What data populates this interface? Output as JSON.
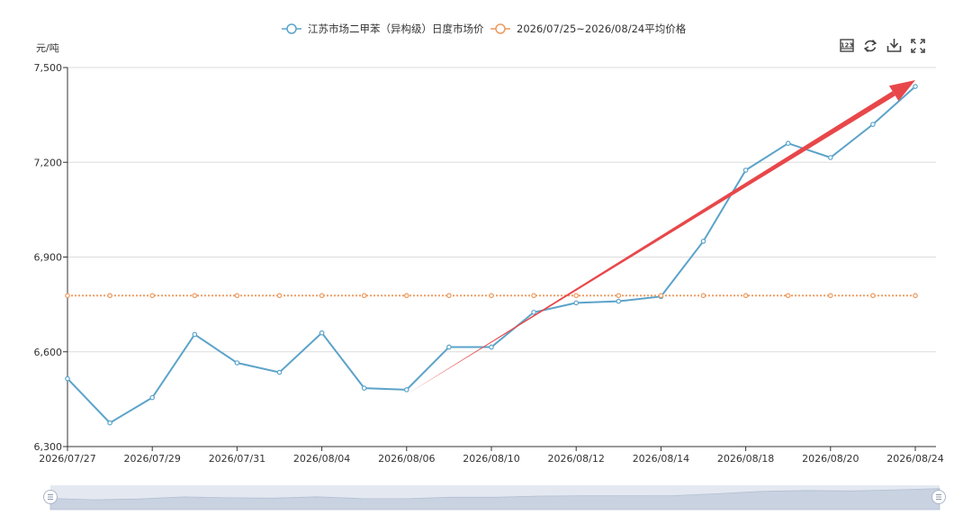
{
  "chart_data": {
    "type": "line",
    "y_unit_label": "元/吨",
    "ylim": [
      6300,
      7500
    ],
    "y_ticks": [
      6300,
      6600,
      6900,
      7200,
      7500
    ],
    "y_tick_labels": [
      "6,300",
      "6,600",
      "6,900",
      "7,200",
      "7,500"
    ],
    "x_tick_labels": [
      "2026/07/27",
      "2026/07/29",
      "2026/07/31",
      "2026/08/04",
      "2026/08/06",
      "2026/08/10",
      "2026/08/12",
      "2026/08/14",
      "2026/08/18",
      "2026/08/20",
      "2026/08/24"
    ],
    "grid": true,
    "legend_position": "top-center",
    "series": [
      {
        "name": "江苏市场二甲苯（异构级）日度市场价",
        "color": "#5ba3c9",
        "values": [
          6515,
          6375,
          6455,
          6655,
          6565,
          6535,
          6660,
          6485,
          6480,
          6615,
          6615,
          6725,
          6755,
          6760,
          6775,
          6950,
          7175,
          7260,
          7215,
          7320,
          7440
        ]
      },
      {
        "name": "2026/07/25~2026/08/24平均价格",
        "color": "#ec9a5e",
        "values": [
          6778,
          6778,
          6778,
          6778,
          6778,
          6778,
          6778,
          6778,
          6778,
          6778,
          6778,
          6778,
          6778,
          6778,
          6778,
          6778,
          6778,
          6778,
          6778,
          6778,
          6778
        ]
      }
    ],
    "annotation": {
      "type": "trend-arrow",
      "color": "#e8474a",
      "from_index": 8,
      "from_value": 6465,
      "to_index": 20,
      "to_value": 7460
    }
  },
  "toolbox": {
    "icons": [
      "data-view-icon",
      "restore-icon",
      "download-icon",
      "fullscreen-icon"
    ]
  },
  "datazoom": {
    "handle_icon": "drag-handle-icon"
  }
}
